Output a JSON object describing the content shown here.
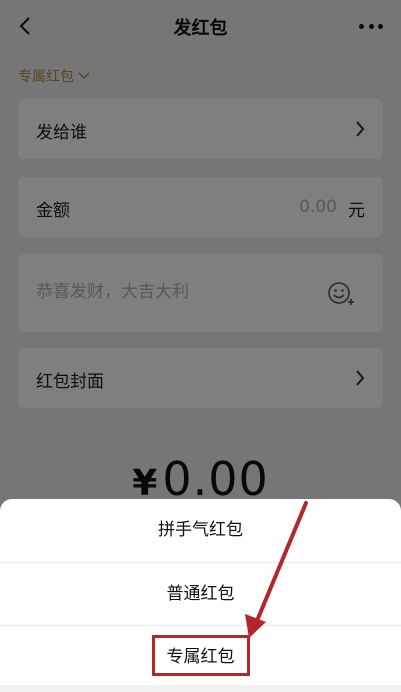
{
  "header": {
    "title": "发红包"
  },
  "type_selector": {
    "label": "专属红包"
  },
  "form": {
    "recipient_label": "发给谁",
    "amount_label": "金额",
    "amount_value": "0.00",
    "amount_unit": "元",
    "greeting_placeholder": "恭喜发财，大吉大利",
    "cover_label": "红包封面"
  },
  "total": {
    "currency": "¥",
    "value": "0.00"
  },
  "sheet": {
    "items": [
      {
        "label": "拼手气红包"
      },
      {
        "label": "普通红包"
      },
      {
        "label": "专属红包"
      }
    ]
  },
  "annotation": {
    "color": "#b3262b",
    "target_item": "专属红包"
  },
  "icons": {
    "back": "back-icon",
    "more": "more-icon",
    "chevron": "chevron-right-icon",
    "emoji": "emoji-icon"
  }
}
